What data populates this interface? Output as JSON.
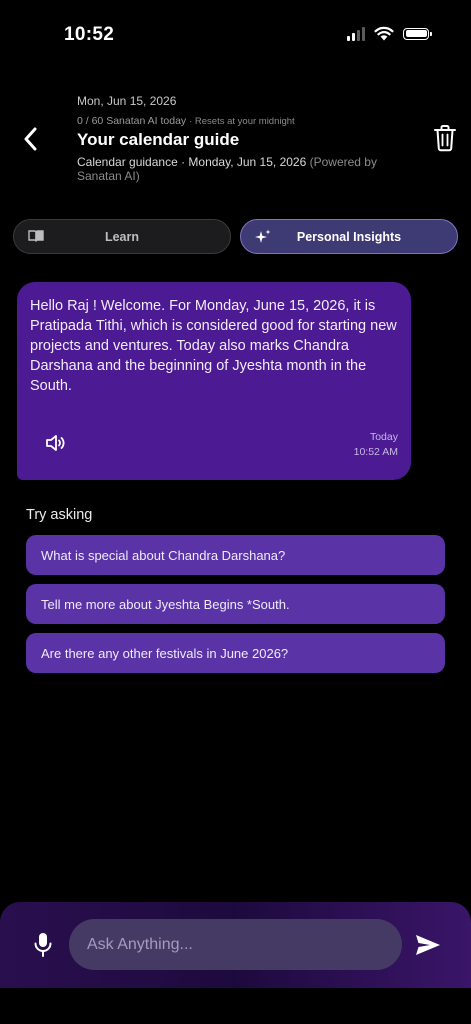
{
  "status_bar": {
    "time": "10:52"
  },
  "header": {
    "date": "Mon, Jun 15, 2026",
    "quota": "0 / 60 Sanatan AI today",
    "quota_note": "· Resets at your midnight",
    "title": "Your calendar guide",
    "subtitle": "Calendar guidance · Monday, Jun 15, 2026",
    "powered_by": "(Powered by Sanatan AI)"
  },
  "tabs": [
    {
      "label": "Learn",
      "icon": "book-icon",
      "active": false
    },
    {
      "label": "Personal Insights",
      "icon": "sparkle-icon",
      "active": true
    }
  ],
  "message": {
    "text": "Hello Raj ! Welcome. For Monday, June 15, 2026, it is Pratipada Tithi, which is considered good for starting new projects and ventures. Today also marks Chandra Darshana and the beginning of Jyeshta month in the South.",
    "day": "Today",
    "time": "10:52 AM"
  },
  "suggestions": {
    "heading": "Try asking",
    "items": [
      "What is special about Chandra Darshana?",
      "Tell me more about Jyeshta Begins *South.",
      "Are there any other festivals in June 2026?"
    ]
  },
  "input": {
    "placeholder": "Ask Anything..."
  },
  "colors": {
    "background": "#000000",
    "bubble": "#4c1a93",
    "suggestion": "#5a34a6",
    "active_tab": "#3e3a73",
    "input_field": "#453a63"
  }
}
